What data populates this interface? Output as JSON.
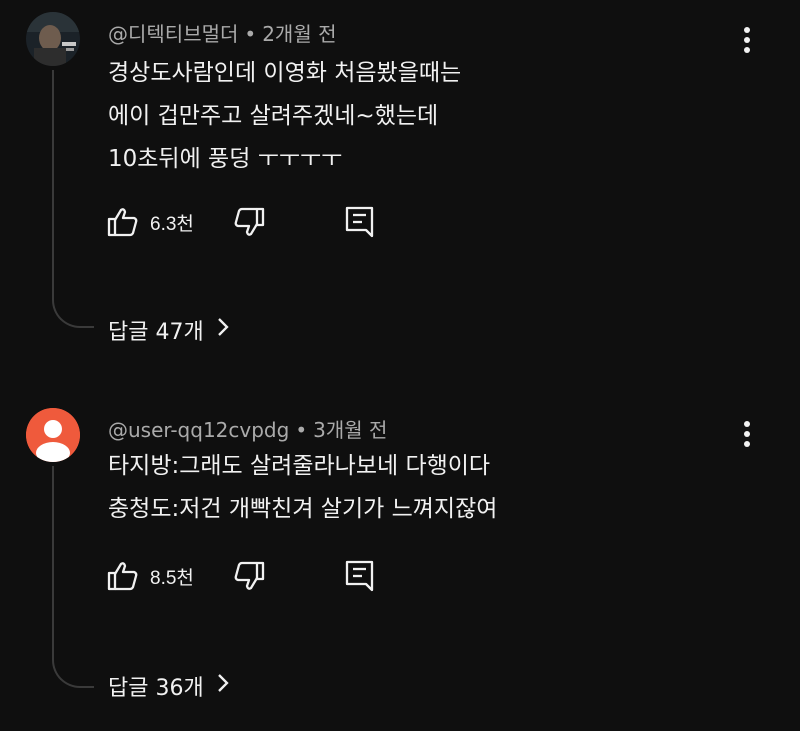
{
  "comments": [
    {
      "author": "@디텍티브멀더",
      "separator": "•",
      "time": "2개월 전",
      "lines": [
        "경상도사람인데 이영화 처음봤을때는",
        "에이 겁만주고 살려주겠네~했는데",
        "10초뒤에 풍덩 ㅜㅜㅜㅜ"
      ],
      "likes": "6.3천",
      "replies_label": "답글 47개",
      "avatar": "photo-avatar"
    },
    {
      "author": "@user-qq12cvpdg",
      "separator": "•",
      "time": "3개월 전",
      "lines": [
        "타지방:그래도 살려줄라나보네 다행이다",
        "충청도:저건 개빡친겨 살기가 느껴지잖여"
      ],
      "likes": "8.5천",
      "replies_label": "답글 36개",
      "avatar": "default-person-avatar",
      "avatar_color": "#ef5a3c"
    }
  ],
  "icons": {
    "like": "thumbs-up-icon",
    "dislike": "thumbs-down-icon",
    "reply": "reply-comment-icon",
    "more": "more-vertical-icon",
    "expand": "chevron-right-icon"
  },
  "colors": {
    "background": "#0f0f0f",
    "text": "#f1f1f1",
    "meta": "#aaaaaa",
    "thread_line": "#3a3a3a"
  }
}
